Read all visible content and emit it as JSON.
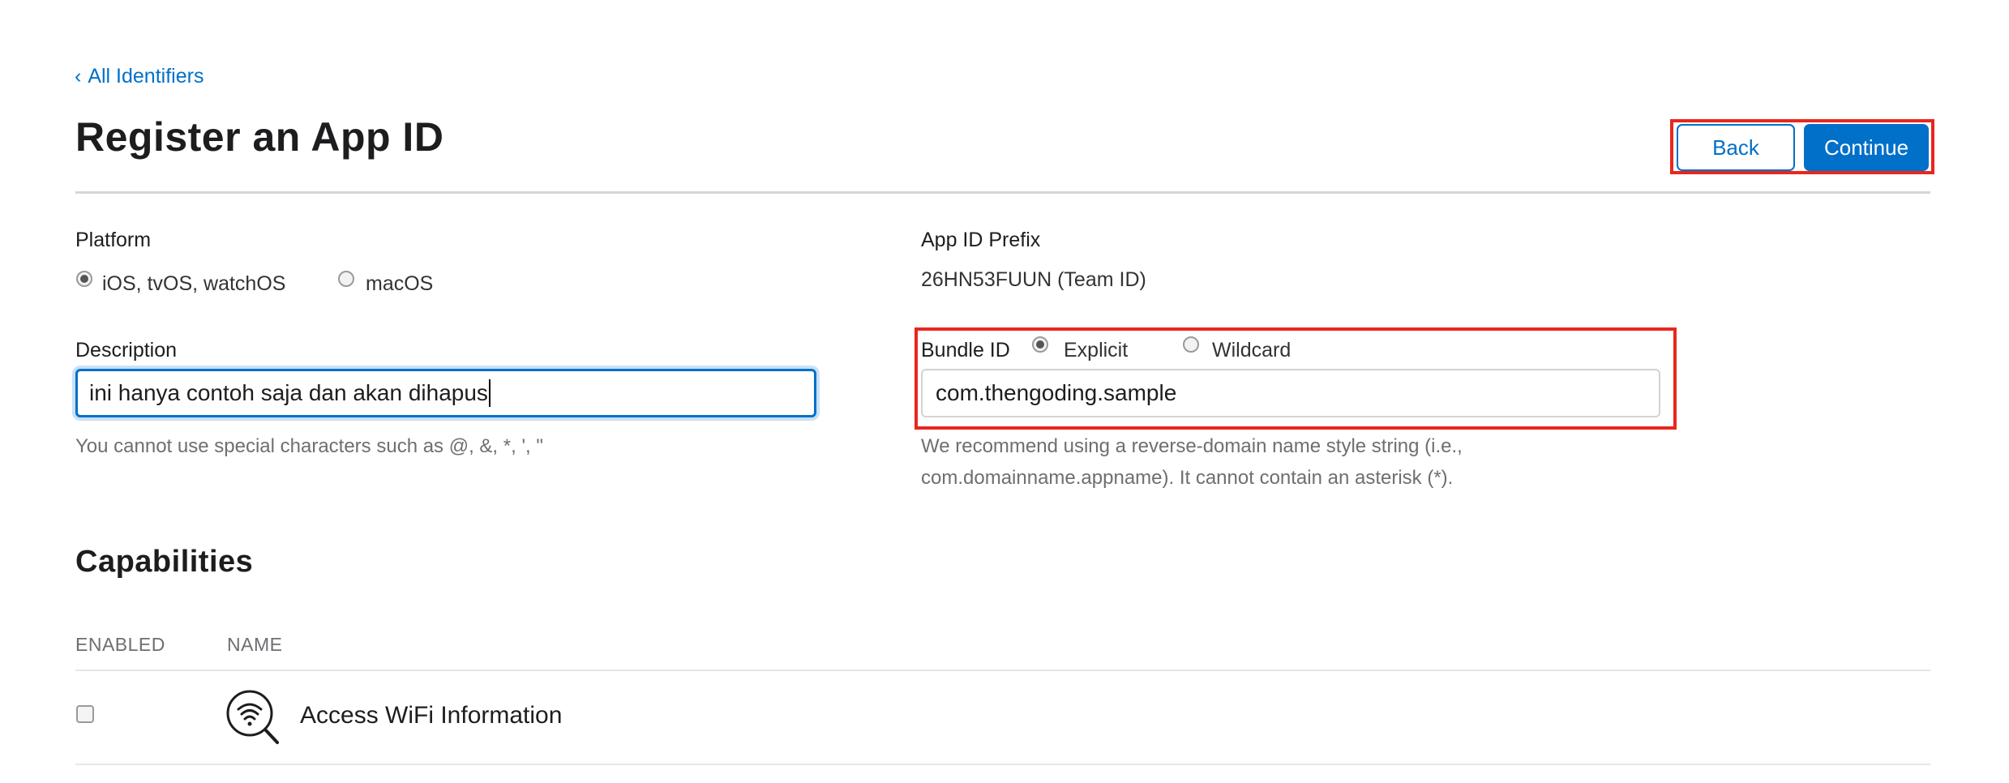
{
  "nav": {
    "back_link": "All Identifiers"
  },
  "page": {
    "title": "Register an App ID"
  },
  "actions": {
    "back_label": "Back",
    "continue_label": "Continue"
  },
  "platform": {
    "label": "Platform",
    "options": [
      {
        "label": "iOS, tvOS, watchOS",
        "selected": true
      },
      {
        "label": "macOS",
        "selected": false
      }
    ]
  },
  "app_id_prefix": {
    "label": "App ID Prefix",
    "value": "26HN53FUUN (Team ID)"
  },
  "description": {
    "label": "Description",
    "value": "ini hanya contoh saja dan akan dihapus",
    "hint": "You cannot use special characters such as @, &, *, ', \""
  },
  "bundle_id": {
    "label": "Bundle ID",
    "options": [
      {
        "label": "Explicit",
        "selected": true
      },
      {
        "label": "Wildcard",
        "selected": false
      }
    ],
    "value": "com.thengoding.sample",
    "hint_line1": "We recommend using a reverse-domain name style string (i.e.,",
    "hint_line2": "com.domainname.appname). It cannot contain an asterisk (*)."
  },
  "capabilities": {
    "title": "Capabilities",
    "columns": {
      "enabled": "ENABLED",
      "name": "NAME"
    },
    "rows": [
      {
        "name": "Access WiFi Information",
        "enabled": false,
        "icon": "wifi-search-icon"
      }
    ]
  },
  "colors": {
    "accent": "#0070c9",
    "highlight": "#e8271f"
  }
}
